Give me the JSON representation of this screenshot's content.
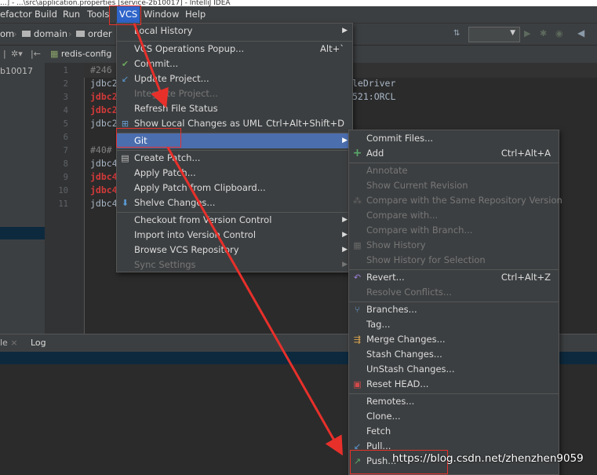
{
  "window": {
    "title": "...] - ...\\src\\application.properties [service-2b10017] - IntelliJ IDEA"
  },
  "menubar": {
    "items": [
      "efactor",
      "Build",
      "Run",
      "Tools",
      "VCS",
      "Window",
      "Help"
    ]
  },
  "navbar": {
    "crumbs": [
      "om",
      "domain",
      "order"
    ]
  },
  "tabs": {
    "file_tab": "redis-config",
    "left_label": "b10017"
  },
  "editor": {
    "line_numbers": [
      "1",
      "2",
      "3",
      "4",
      "5",
      "6",
      "7",
      "8",
      "9",
      "10",
      "11"
    ],
    "lines": [
      {
        "text": "#246",
        "color": "#808080"
      },
      {
        "text": "jdbc2",
        "color": "#a9b7c6"
      },
      {
        "text": "jdbc2",
        "color": "#d33a3a"
      },
      {
        "text": "jdbc2",
        "color": "#d33a3a"
      },
      {
        "text": "jdbc2",
        "color": "#a9b7c6"
      },
      {
        "text": "",
        "color": "#a9b7c6"
      },
      {
        "text": "#40#",
        "color": "#808080"
      },
      {
        "text": "jdbc4",
        "color": "#a9b7c6"
      },
      {
        "text": "jdbc4",
        "color": "#d33a3a"
      },
      {
        "text": "jdbc4",
        "color": "#d33a3a"
      },
      {
        "text": "jdbc4",
        "color": "#a9b7c6"
      }
    ],
    "right_fragments": [
      "leDriver",
      "521:ORCL"
    ]
  },
  "bottom_panel": {
    "tab1": "le",
    "tab2": "Log"
  },
  "vcs_menu": {
    "items": [
      {
        "label": "Local History",
        "shortcut": "",
        "submenu": true,
        "disabled": false,
        "icon": ""
      },
      {
        "label": "VCS Operations Popup...",
        "shortcut": "Alt+`",
        "submenu": false,
        "disabled": false,
        "icon": ""
      },
      {
        "label": "Commit...",
        "shortcut": "",
        "submenu": false,
        "disabled": false,
        "icon": "commit-icon"
      },
      {
        "label": "Update Project...",
        "shortcut": "",
        "submenu": false,
        "disabled": false,
        "icon": "update-icon"
      },
      {
        "label": "Integrate Project...",
        "shortcut": "",
        "submenu": false,
        "disabled": true,
        "icon": ""
      },
      {
        "label": "Refresh File Status",
        "shortcut": "",
        "submenu": false,
        "disabled": false,
        "icon": ""
      },
      {
        "label": "Show Local Changes as UML",
        "shortcut": "Ctrl+Alt+Shift+D",
        "submenu": false,
        "disabled": false,
        "icon": "uml-icon"
      },
      {
        "label": "Git",
        "shortcut": "",
        "submenu": true,
        "disabled": false,
        "icon": ""
      },
      {
        "label": "Create Patch...",
        "shortcut": "",
        "submenu": false,
        "disabled": false,
        "icon": "patch-icon"
      },
      {
        "label": "Apply Patch...",
        "shortcut": "",
        "submenu": false,
        "disabled": false,
        "icon": ""
      },
      {
        "label": "Apply Patch from Clipboard...",
        "shortcut": "",
        "submenu": false,
        "disabled": false,
        "icon": ""
      },
      {
        "label": "Shelve Changes...",
        "shortcut": "",
        "submenu": false,
        "disabled": false,
        "icon": "shelve-icon"
      },
      {
        "label": "Checkout from Version Control",
        "shortcut": "",
        "submenu": true,
        "disabled": false,
        "icon": ""
      },
      {
        "label": "Import into Version Control",
        "shortcut": "",
        "submenu": true,
        "disabled": false,
        "icon": ""
      },
      {
        "label": "Browse VCS Repository",
        "shortcut": "",
        "submenu": true,
        "disabled": false,
        "icon": ""
      },
      {
        "label": "Sync Settings",
        "shortcut": "",
        "submenu": true,
        "disabled": true,
        "icon": ""
      }
    ]
  },
  "git_menu": {
    "items": [
      {
        "label": "Commit Files...",
        "shortcut": "",
        "disabled": false,
        "icon": ""
      },
      {
        "label": "Add",
        "shortcut": "Ctrl+Alt+A",
        "disabled": false,
        "icon": "add-icon"
      },
      {
        "label": "Annotate",
        "shortcut": "",
        "disabled": true,
        "icon": ""
      },
      {
        "label": "Show Current Revision",
        "shortcut": "",
        "disabled": true,
        "icon": ""
      },
      {
        "label": "Compare with the Same Repository Version",
        "shortcut": "",
        "disabled": true,
        "icon": "compare-icon"
      },
      {
        "label": "Compare with...",
        "shortcut": "",
        "disabled": true,
        "icon": ""
      },
      {
        "label": "Compare with Branch...",
        "shortcut": "",
        "disabled": true,
        "icon": ""
      },
      {
        "label": "Show History",
        "shortcut": "",
        "disabled": true,
        "icon": "history-icon"
      },
      {
        "label": "Show History for Selection",
        "shortcut": "",
        "disabled": true,
        "icon": ""
      },
      {
        "label": "Revert...",
        "shortcut": "Ctrl+Alt+Z",
        "disabled": false,
        "icon": "revert-icon"
      },
      {
        "label": "Resolve Conflicts...",
        "shortcut": "",
        "disabled": true,
        "icon": ""
      },
      {
        "label": "Branches...",
        "shortcut": "",
        "disabled": false,
        "icon": "branches-icon"
      },
      {
        "label": "Tag...",
        "shortcut": "",
        "disabled": false,
        "icon": ""
      },
      {
        "label": "Merge Changes...",
        "shortcut": "",
        "disabled": false,
        "icon": "merge-icon"
      },
      {
        "label": "Stash Changes...",
        "shortcut": "",
        "disabled": false,
        "icon": ""
      },
      {
        "label": "UnStash Changes...",
        "shortcut": "",
        "disabled": false,
        "icon": ""
      },
      {
        "label": "Reset HEAD...",
        "shortcut": "",
        "disabled": false,
        "icon": "reset-icon"
      },
      {
        "label": "Remotes...",
        "shortcut": "",
        "disabled": false,
        "icon": ""
      },
      {
        "label": "Clone...",
        "shortcut": "",
        "disabled": false,
        "icon": ""
      },
      {
        "label": "Fetch",
        "shortcut": "",
        "disabled": false,
        "icon": ""
      },
      {
        "label": "Pull...",
        "shortcut": "",
        "disabled": false,
        "icon": "pull-icon"
      },
      {
        "label": "Push...",
        "shortcut": "",
        "disabled": false,
        "icon": "push-icon"
      }
    ]
  },
  "watermark": "https://blog.csdn.net/zhenzhen9059",
  "colors": {
    "highlight": "#4b6eaf",
    "annotation": "#e8302b",
    "menu_bg": "#3c3f41"
  }
}
